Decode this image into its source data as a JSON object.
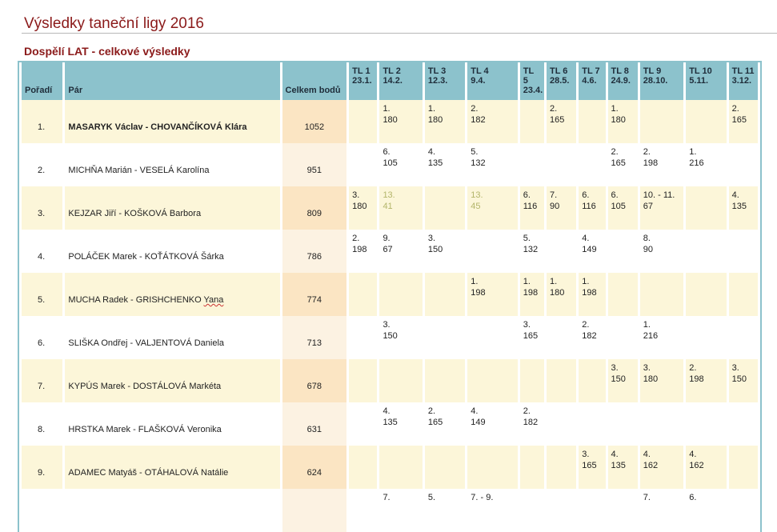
{
  "page": {
    "title": "Výsledky taneční ligy 2016",
    "section_title": "Dospělí LAT - celkové výsledky"
  },
  "table": {
    "headers": {
      "rank": "Pořadí",
      "pair": "Pár",
      "points": "Celkem bodů",
      "tl": [
        {
          "name": "TL 1",
          "date": "23.1."
        },
        {
          "name": "TL 2",
          "date": "14.2."
        },
        {
          "name": "TL 3",
          "date": "12.3."
        },
        {
          "name": "TL 4",
          "date": "9.4."
        },
        {
          "name": "TL 5",
          "date": "23.4."
        },
        {
          "name": "TL 6",
          "date": "28.5."
        },
        {
          "name": "TL 7",
          "date": "4.6."
        },
        {
          "name": "TL 8",
          "date": "24.9."
        },
        {
          "name": "TL 9",
          "date": "28.10."
        },
        {
          "name": "TL 10",
          "date": "5.11."
        },
        {
          "name": "TL 11",
          "date": "3.12."
        }
      ]
    },
    "rows": [
      {
        "rank": "1.",
        "pair": "MASARYK Václav - CHOVANČÍKOVÁ Klára",
        "points": "1052",
        "results": [
          [
            "",
            ""
          ],
          [
            "1.",
            "180"
          ],
          [
            "1.",
            "180"
          ],
          [
            "2.",
            "182"
          ],
          [
            "",
            ""
          ],
          [
            "2.",
            "165"
          ],
          [
            "",
            ""
          ],
          [
            "1.",
            "180"
          ],
          [
            "",
            ""
          ],
          [
            "",
            ""
          ],
          [
            "2.",
            "165"
          ]
        ]
      },
      {
        "rank": "2.",
        "pair": "MICHŇA Marián - VESELÁ Karolína",
        "points": "951",
        "results": [
          [
            "",
            ""
          ],
          [
            "6.",
            "105"
          ],
          [
            "4.",
            "135"
          ],
          [
            "5.",
            "132"
          ],
          [
            "",
            ""
          ],
          [
            "",
            ""
          ],
          [
            "",
            ""
          ],
          [
            "2.",
            "165"
          ],
          [
            "2.",
            "198"
          ],
          [
            "1.",
            "216"
          ],
          [
            "",
            ""
          ]
        ]
      },
      {
        "rank": "3.",
        "pair": "KEJZAR Jiří - KOŠKOVÁ Barbora",
        "points": "809",
        "results": [
          [
            "3.",
            "180"
          ],
          [
            "13.",
            "41"
          ],
          [
            "",
            ""
          ],
          [
            "13.",
            "45"
          ],
          [
            "6.",
            "116"
          ],
          [
            "7.",
            "90"
          ],
          [
            "6.",
            "116"
          ],
          [
            "6.",
            "105"
          ],
          [
            "10. - 11.",
            "67"
          ],
          [
            "",
            ""
          ],
          [
            "4.",
            "135"
          ]
        ]
      },
      {
        "rank": "4.",
        "pair": "POLÁČEK Marek - KOŤÁTKOVÁ Šárka",
        "points": "786",
        "results": [
          [
            "2.",
            "198"
          ],
          [
            "9.",
            "67"
          ],
          [
            "3.",
            "150"
          ],
          [
            "",
            ""
          ],
          [
            "5.",
            "132"
          ],
          [
            "",
            ""
          ],
          [
            "4.",
            "149"
          ],
          [
            "",
            ""
          ],
          [
            "8.",
            "90"
          ],
          [
            "",
            ""
          ],
          [
            "",
            ""
          ]
        ]
      },
      {
        "rank": "5.",
        "pair_main": "MUCHA Radek - GRISHCHENKO ",
        "pair_tail": "Yana",
        "points": "774",
        "results": [
          [
            "",
            ""
          ],
          [
            "",
            ""
          ],
          [
            "",
            ""
          ],
          [
            "1.",
            "198"
          ],
          [
            "1.",
            "198"
          ],
          [
            "1.",
            "180"
          ],
          [
            "1.",
            "198"
          ],
          [
            "",
            ""
          ],
          [
            "",
            ""
          ],
          [
            "",
            ""
          ],
          [
            "",
            ""
          ]
        ]
      },
      {
        "rank": "6.",
        "pair": "SLIŠKA Ondřej - VALJENTOVÁ Daniela",
        "points": "713",
        "results": [
          [
            "",
            ""
          ],
          [
            "3.",
            "150"
          ],
          [
            "",
            ""
          ],
          [
            "",
            ""
          ],
          [
            "3.",
            "165"
          ],
          [
            "",
            ""
          ],
          [
            "2.",
            "182"
          ],
          [
            "",
            ""
          ],
          [
            "1.",
            "216"
          ],
          [
            "",
            ""
          ],
          [
            "",
            ""
          ]
        ]
      },
      {
        "rank": "7.",
        "pair": "KYPÚS Marek - DOSTÁLOVÁ Markéta",
        "points": "678",
        "results": [
          [
            "",
            ""
          ],
          [
            "",
            ""
          ],
          [
            "",
            ""
          ],
          [
            "",
            ""
          ],
          [
            "",
            ""
          ],
          [
            "",
            ""
          ],
          [
            "",
            ""
          ],
          [
            "3.",
            "150"
          ],
          [
            "3.",
            "180"
          ],
          [
            "2.",
            "198"
          ],
          [
            "3.",
            "150"
          ]
        ]
      },
      {
        "rank": "8.",
        "pair": "HRSTKA Marek - FLAŠKOVÁ Veronika",
        "points": "631",
        "results": [
          [
            "",
            ""
          ],
          [
            "4.",
            "135"
          ],
          [
            "2.",
            "165"
          ],
          [
            "4.",
            "149"
          ],
          [
            "2.",
            "182"
          ],
          [
            "",
            ""
          ],
          [
            "",
            ""
          ],
          [
            "",
            ""
          ],
          [
            "",
            ""
          ],
          [
            "",
            ""
          ],
          [
            "",
            ""
          ]
        ]
      },
      {
        "rank": "9.",
        "pair": "ADAMEC Matyáš - OTÁHALOVÁ Natálie",
        "points": "624",
        "results": [
          [
            "",
            ""
          ],
          [
            "",
            ""
          ],
          [
            "",
            ""
          ],
          [
            "",
            ""
          ],
          [
            "",
            ""
          ],
          [
            "",
            ""
          ],
          [
            "3.",
            "165"
          ],
          [
            "4.",
            "135"
          ],
          [
            "4.",
            "162"
          ],
          [
            "4.",
            "162"
          ],
          [
            "",
            ""
          ]
        ]
      },
      {
        "rank": "",
        "pair": "",
        "points": "",
        "results": [
          [
            "",
            ""
          ],
          [
            "7.",
            ""
          ],
          [
            "5.",
            ""
          ],
          [
            "7. - 9.",
            ""
          ],
          [
            "",
            ""
          ],
          [
            "",
            ""
          ],
          [
            "",
            ""
          ],
          [
            "",
            ""
          ],
          [
            "7.",
            ""
          ],
          [
            "6.",
            ""
          ],
          [
            "",
            ""
          ]
        ]
      }
    ]
  },
  "colors": {
    "title": "#8b1a1a",
    "header_bg": "#8cc2cc",
    "row_odd": "#fcf6d9",
    "points_bg": "#fbe5c3",
    "dim_result": "#b3b56a"
  }
}
